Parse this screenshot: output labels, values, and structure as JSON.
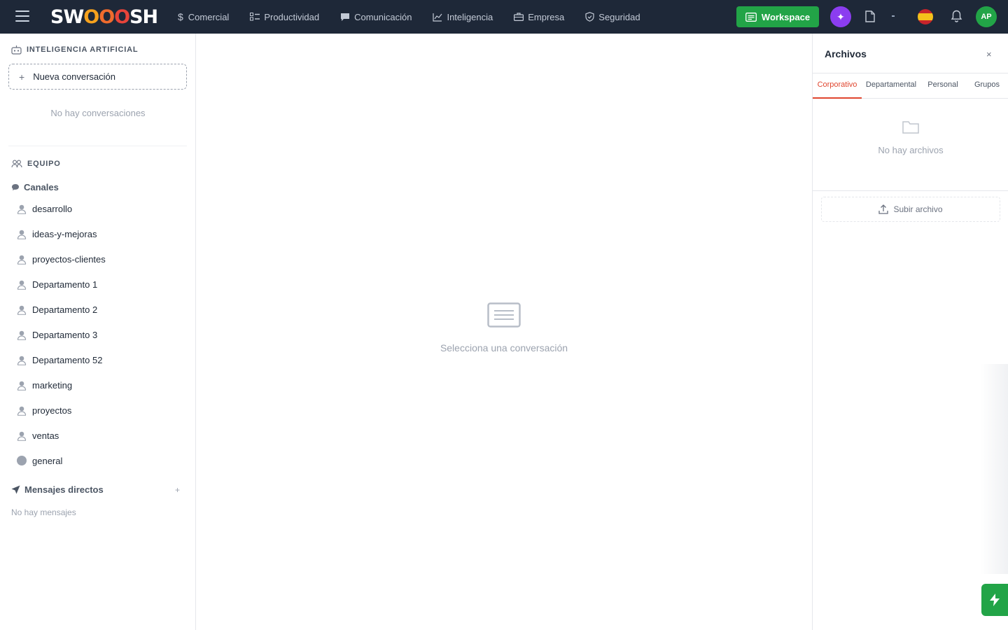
{
  "app": {
    "logo": {
      "s": "SW",
      "o1": "O",
      "o2": "O",
      "o3": "O",
      "tail": "SH"
    }
  },
  "nav": {
    "items": [
      {
        "label": "Comercial",
        "icon": "dollar-icon"
      },
      {
        "label": "Productividad",
        "icon": "checklist-icon"
      },
      {
        "label": "Comunicación",
        "icon": "chat-icon"
      },
      {
        "label": "Inteligencia",
        "icon": "chart-icon"
      },
      {
        "label": "Empresa",
        "icon": "briefcase-icon"
      },
      {
        "label": "Seguridad",
        "icon": "shield-icon"
      }
    ],
    "dollar_symbol": "$",
    "workspace_label": "Workspace",
    "ai_symbol": "✦",
    "avatar_initials": "AP"
  },
  "sidebar": {
    "ai_section_title": "INTELIGENCIA ARTIFICIAL",
    "new_conversation_label": "Nueva conversación",
    "plus_symbol": "+",
    "empty_conversations": "No hay conversaciones",
    "team_section_title": "EQUIPO",
    "channels_label": "Canales",
    "channels": [
      {
        "name": "desarrollo"
      },
      {
        "name": "ideas-y-mejoras"
      },
      {
        "name": "proyectos-clientes"
      },
      {
        "name": "Departamento 1"
      },
      {
        "name": "Departamento 2"
      },
      {
        "name": "Departamento 3"
      },
      {
        "name": "Departamento 52"
      },
      {
        "name": "marketing"
      },
      {
        "name": "proyectos"
      },
      {
        "name": "ventas"
      },
      {
        "name": "general"
      }
    ],
    "dm_label": "Mensajes directos",
    "dm_add": "+",
    "dm_empty": "No hay mensajes"
  },
  "center": {
    "empty_text": "Selecciona una conversación"
  },
  "files_panel": {
    "title": "Archivos",
    "close_symbol": "×",
    "tabs": [
      {
        "label": "Corporativo",
        "active": true
      },
      {
        "label": "Departamental",
        "active": false
      },
      {
        "label": "Personal",
        "active": false
      },
      {
        "label": "Grupos",
        "active": false
      }
    ],
    "empty_text": "No hay archivos",
    "upload_label": "Subir archivo"
  },
  "colors": {
    "topbar": "#1e2838",
    "accent_green": "#22a447",
    "ai_purple": "#8b3df0",
    "active_tab": "#e0462f"
  }
}
